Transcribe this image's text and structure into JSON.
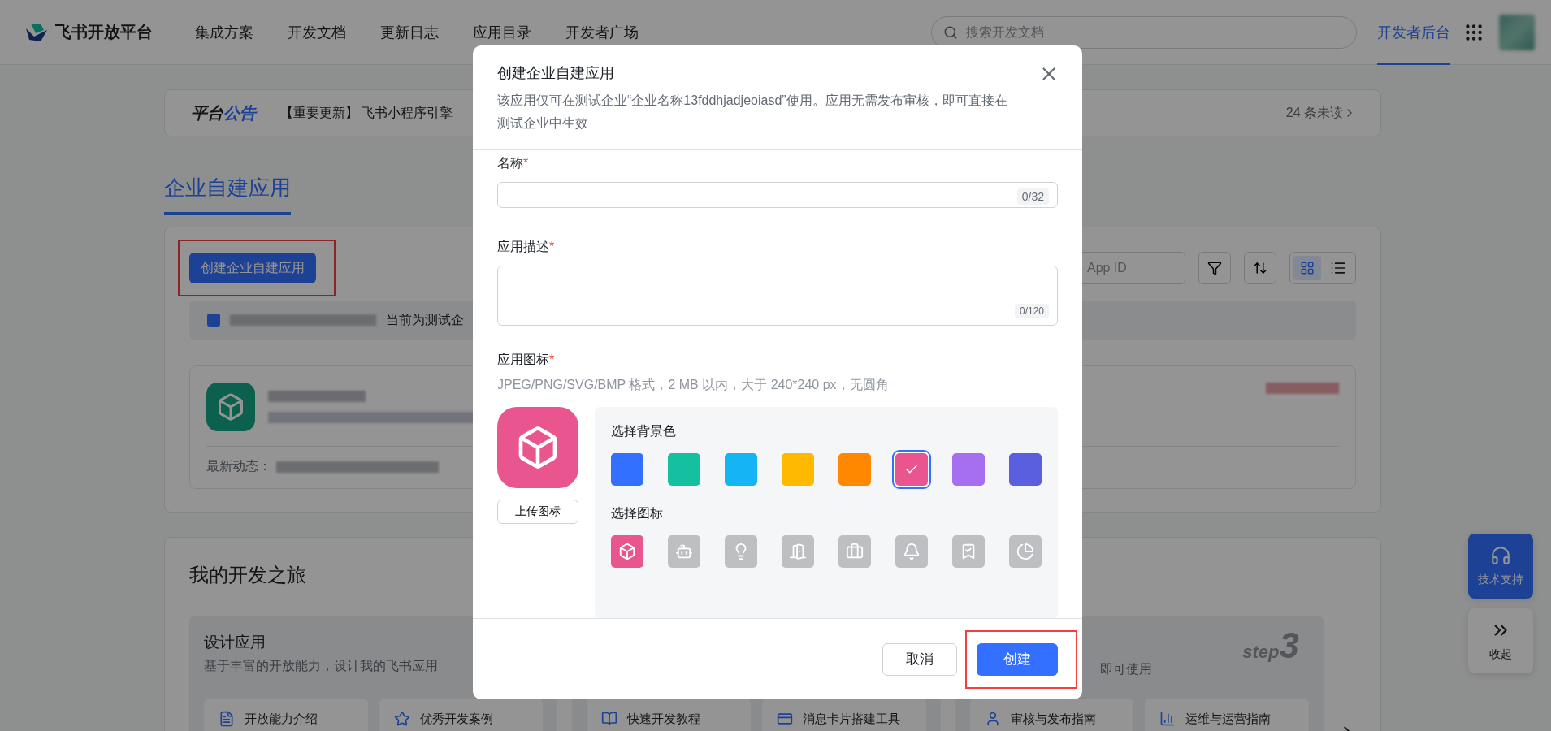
{
  "header": {
    "logo_text": "飞书开放平台",
    "nav": [
      {
        "label": "集成方案"
      },
      {
        "label": "开发文档"
      },
      {
        "label": "更新日志"
      },
      {
        "label": "应用目录"
      },
      {
        "label": "开发者广场"
      }
    ],
    "search": {
      "placeholder": "搜索开发文档"
    },
    "console_link": {
      "label": "开发者后台",
      "selected": true
    }
  },
  "announcement": {
    "title": "平台",
    "title_accent": "公告",
    "text": "【重要更新】 飞书小程序引擎",
    "unread": "24 条未读"
  },
  "section_tab": {
    "label": "企业自建应用",
    "selected": true
  },
  "apps_panel": {
    "create_button": {
      "label": "创建企业自建应用",
      "highlighted": true
    },
    "search": {
      "placeholder": "App ID"
    },
    "view_modes": [
      {
        "kind": "grid",
        "selected": true
      },
      {
        "kind": "list",
        "selected": false
      }
    ],
    "notice": {
      "text": "当前为测试企"
    },
    "app_card": {
      "latest_label": "最新动态："
    }
  },
  "journey": {
    "title": "我的开发之旅",
    "steps": [
      {
        "title": "设计应用",
        "description": "基于丰富的开放能力，设计我的飞书应用",
        "links": [
          {
            "kind": "doc",
            "label": "开放能力介绍"
          },
          {
            "kind": "star",
            "label": "优秀开发案例"
          }
        ]
      },
      {
        "links": [
          {
            "kind": "book",
            "label": "快速开发教程"
          },
          {
            "kind": "card",
            "label": "消息卡片搭建工具"
          }
        ]
      },
      {
        "step_word": "step",
        "step_number": "3",
        "description": "即可使用",
        "links": [
          {
            "kind": "person",
            "label": "审核与发布指南"
          },
          {
            "kind": "chart",
            "label": "运维与运营指南"
          }
        ]
      }
    ]
  },
  "float_buttons": [
    {
      "kind": "support",
      "label": "技术支持"
    },
    {
      "kind": "collapse",
      "label": "收起"
    }
  ],
  "dialog": {
    "title": "创建企业自建应用",
    "description": "该应用仅可在测试企业“企业名称13fddhjadjeoiasd”使用。应用无需发布审核，即可直接在测试企业中生效",
    "fields": [
      {
        "kind": "input",
        "label": "名称",
        "required_mark": "*",
        "counter": "0/32"
      },
      {
        "kind": "textarea",
        "label": "应用描述",
        "required_mark": "*",
        "counter": "0/120"
      }
    ],
    "icon_field": {
      "label": "应用图标",
      "required_mark": "*",
      "hint": "JPEG/PNG/SVG/BMP 格式，2 MB 以内，大于 240*240 px，无圆角",
      "upload_button": "上传图标",
      "color_title": "选择背景色",
      "colors": [
        {
          "color": "#3370ff",
          "selected": false
        },
        {
          "color": "#14c0a0",
          "selected": false
        },
        {
          "color": "#14b4f5",
          "selected": false
        },
        {
          "color": "#ffba00",
          "selected": false
        },
        {
          "color": "#ff8800",
          "selected": false
        },
        {
          "color": "#e8558f",
          "selected": true
        },
        {
          "color": "#a66ef0",
          "selected": false
        },
        {
          "color": "#5a5fe0",
          "selected": false
        }
      ],
      "icon_title": "选择图标",
      "icons": [
        {
          "kind": "cube",
          "selected": true
        },
        {
          "kind": "robot",
          "selected": false
        },
        {
          "kind": "bulb",
          "selected": false
        },
        {
          "kind": "door",
          "selected": false
        },
        {
          "kind": "briefcase",
          "selected": false
        },
        {
          "kind": "bell",
          "selected": false
        },
        {
          "kind": "bookmark",
          "selected": false
        },
        {
          "kind": "pie",
          "selected": false
        }
      ]
    },
    "buttons": [
      {
        "kind": "secondary",
        "label": "取消",
        "highlighted": false
      },
      {
        "kind": "primary",
        "label": "创建",
        "highlighted": true
      }
    ]
  }
}
